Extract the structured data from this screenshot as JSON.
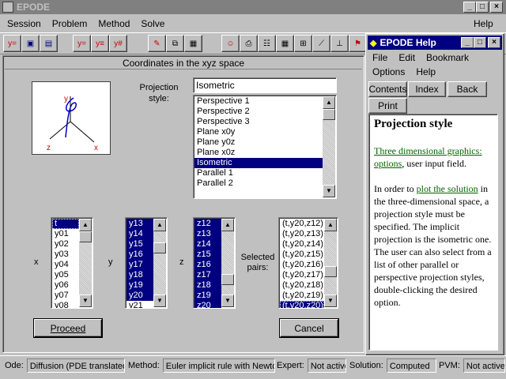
{
  "app": {
    "title": "EPODE",
    "menu": [
      "Session",
      "Problem",
      "Method",
      "Solve",
      "Help"
    ]
  },
  "toolbar": {
    "icons": [
      "ye-new-icon",
      "save-icon",
      "save-all-icon",
      "separator",
      "ye-icon",
      "ye-edit-icon",
      "ye-grid-icon",
      "separator",
      "edit-icon",
      "copy-icon",
      "paste-icon",
      "separator",
      "person-icon",
      "printer-icon",
      "table-icon",
      "matrix-icon",
      "chart-icon",
      "chart-edit-icon",
      "axes-icon",
      "flag-icon"
    ]
  },
  "main": {
    "panel_title": "Coordinates in the xyz space",
    "projection_label_line1": "Projection",
    "projection_label_line2": "style:",
    "projection_value": "Isometric",
    "projection_options": [
      "Perspective 1",
      "Perspective 2",
      "Perspective 3",
      "Plane x0y",
      "Plane y0z",
      "Plane x0z",
      "Isometric",
      "Parallel 1",
      "Parallel 2"
    ],
    "projection_selected_index": 6,
    "axis_glyph_labels": {
      "x": "x",
      "y": "y",
      "z": "z"
    },
    "x_label": "x",
    "y_label": "y",
    "z_label": "z",
    "selected_label_line1": "Selected",
    "selected_label_line2": "pairs:",
    "x_list": [
      "t",
      "y01",
      "y02",
      "y03",
      "y04",
      "y05",
      "y06",
      "y07",
      "y08"
    ],
    "y_list": [
      "y13",
      "y14",
      "y15",
      "y16",
      "y17",
      "y18",
      "y19",
      "y20",
      "y21"
    ],
    "z_list": [
      "z12",
      "z13",
      "z14",
      "z15",
      "z16",
      "z17",
      "z18",
      "z19",
      "z20"
    ],
    "pairs_list": [
      "(t,y20,z12)",
      "(t,y20,z13)",
      "(t,y20,z14)",
      "(t,y20,z15)",
      "(t,y20,z16)",
      "(t,y20,z17)",
      "(t,y20,z18)",
      "(t,y20,z19)",
      "(t,y20,z20)"
    ],
    "proceed_label": "Proceed",
    "cancel_label": "Cancel"
  },
  "status": {
    "ode_cap": "Ode:",
    "ode_val": "Diffusion (PDE translated i",
    "method_cap": "Method:",
    "method_val": "Euler implicit rule with Newton",
    "expert_cap": "Expert:",
    "expert_val": "Not active",
    "solution_cap": "Solution:",
    "solution_val": "Computed",
    "pvm_cap": "PVM:",
    "pvm_val": "Not active"
  },
  "help": {
    "title": "EPODE Help",
    "menu_row1": [
      "File",
      "Edit",
      "Bookmark"
    ],
    "menu_row2": [
      "Options",
      "Help"
    ],
    "tabs": [
      "Contents",
      "Index",
      "Back"
    ],
    "print_label": "Print",
    "heading": "Projection style",
    "link1": "Three dimensional graphics: options",
    "after_link1": ", user input field.",
    "p2_before": "In order to ",
    "link2": "plot the solution",
    "p2_after": " in the three-dimensional space, a projection style must be specified. The implicit projection is the isometric one. The user can also select from a list of other parallel or perspective projection styles, double-clicking the desired option."
  },
  "colors": {
    "titlebar_active": "#000080",
    "titlebar_inactive": "#808080",
    "selection": "#000080",
    "link": "#006400"
  }
}
